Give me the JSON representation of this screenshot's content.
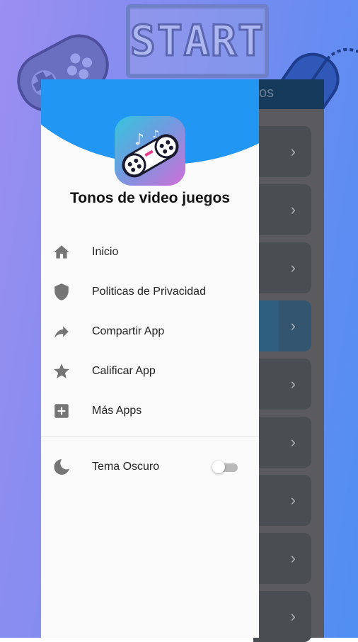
{
  "background": {
    "start_text": "START",
    "gradient": [
      "#9b8ff0",
      "#4f8ef2"
    ]
  },
  "app_behind": {
    "title_fragment": "os",
    "item_count": 9,
    "chevron": "›"
  },
  "drawer": {
    "app_name": "Tonos de video juegos",
    "accent_color": "#2196f3",
    "icon": "gamepad-music-icon",
    "menu": [
      {
        "label": "Inicio",
        "icon": "home-icon"
      },
      {
        "label": "Politicas de Privacidad",
        "icon": "shield-icon"
      },
      {
        "label": "Compartir App",
        "icon": "share-icon"
      },
      {
        "label": "Calificar App",
        "icon": "star-icon"
      },
      {
        "label": "Más Apps",
        "icon": "add-box-icon"
      }
    ],
    "settings": {
      "dark_theme_label": "Tema Oscuro",
      "dark_theme_icon": "moon-icon",
      "dark_theme_enabled": false
    }
  }
}
